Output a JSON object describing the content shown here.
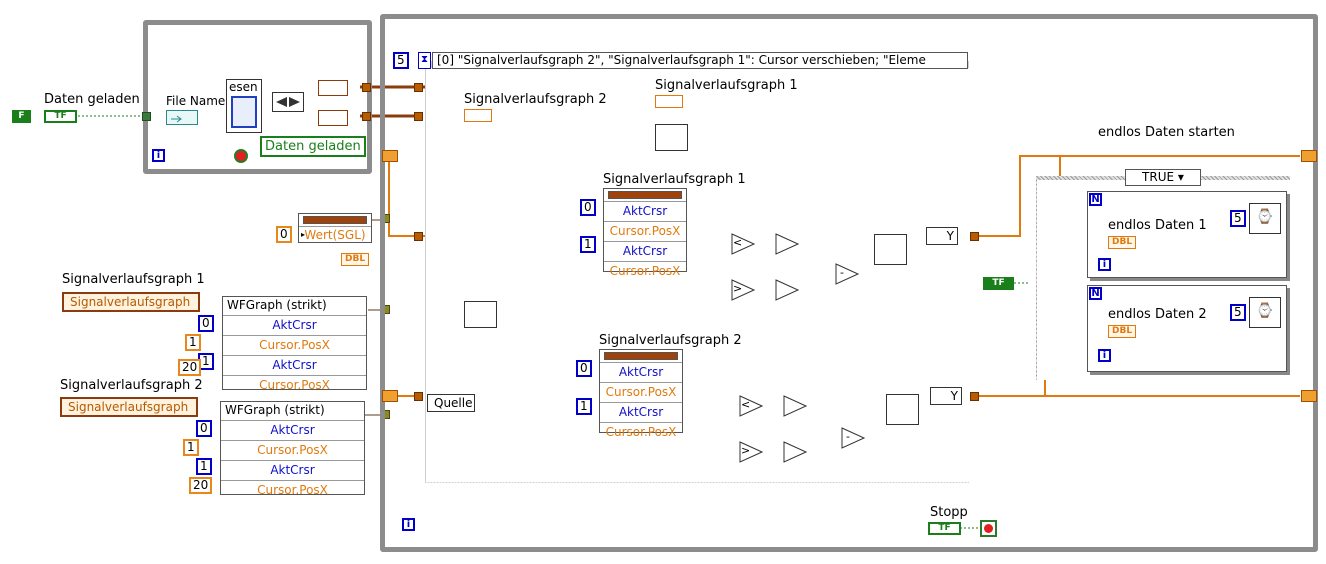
{
  "left_panel": {
    "daten_geladen_label": "Daten geladen",
    "daten_geladen_bool": "TF",
    "const_f": "F",
    "file_name_label": "File Name",
    "lesen_label": "esen",
    "daten_geladen_indicator_label": "Daten geladen"
  },
  "wert_node": {
    "label": "Wert(SGL)",
    "input": "0",
    "dbl": "DBL"
  },
  "sv1_node": {
    "ref_label": "Signalverlaufsgraph 1",
    "ref_text": "Signalverlaufsgraph",
    "title": "WFGraph (strikt)",
    "rows": [
      "AktCrsr",
      "Cursor.PosX",
      "AktCrsr",
      "Cursor.PosX"
    ],
    "inputs": [
      "0",
      "1",
      "1",
      "20"
    ]
  },
  "sv2_node": {
    "ref_label": "Signalverlaufsgraph 2",
    "ref_text": "Signalverlaufsgraph",
    "title": "WFGraph (strikt)",
    "rows": [
      "AktCrsr",
      "Cursor.PosX",
      "AktCrsr",
      "Cursor.PosX"
    ],
    "inputs": [
      "0",
      "1",
      "1",
      "20"
    ]
  },
  "event": {
    "timeout": "5",
    "selector": "[0] \"Signalverlaufsgraph 2\", \"Signalverlaufsgraph 1\": Cursor verschieben;  \"Eleme",
    "sv1_label": "Signalverlaufsgraph 1",
    "sv2_label": "Signalverlaufsgraph 2",
    "quelle": "Quelle",
    "prop1": {
      "label": "Signalverlaufsgraph 1",
      "rows": [
        "AktCrsr",
        "Cursor.PosX",
        "AktCrsr",
        "Cursor.PosX"
      ],
      "inputs": [
        "0",
        "1"
      ]
    },
    "prop2": {
      "label": "Signalverlaufsgraph 2",
      "rows": [
        "AktCrsr",
        "Cursor.PosX",
        "AktCrsr",
        "Cursor.PosX"
      ],
      "inputs": [
        "0",
        "1"
      ]
    },
    "less": "<",
    "greater": ">",
    "minus": "-",
    "y_label": "Y"
  },
  "case": {
    "title": "endlos Daten starten",
    "selector": "TRUE",
    "loop1_label": "endlos Daten 1",
    "loop1_wait": "5",
    "loop2_label": "endlos Daten 2",
    "loop2_wait": "5",
    "dbl": "DBL",
    "n": "N",
    "info": "i",
    "tf": "TF"
  },
  "stop": {
    "label": "Stopp",
    "bool": "TF"
  },
  "colors": {
    "wire_orange": "#e07a10",
    "wire_brown": "#8c3b0c",
    "frame_gray": "#8c8c8c",
    "bool_green": "#1a7f1a",
    "int_blue": "#0000c8"
  }
}
